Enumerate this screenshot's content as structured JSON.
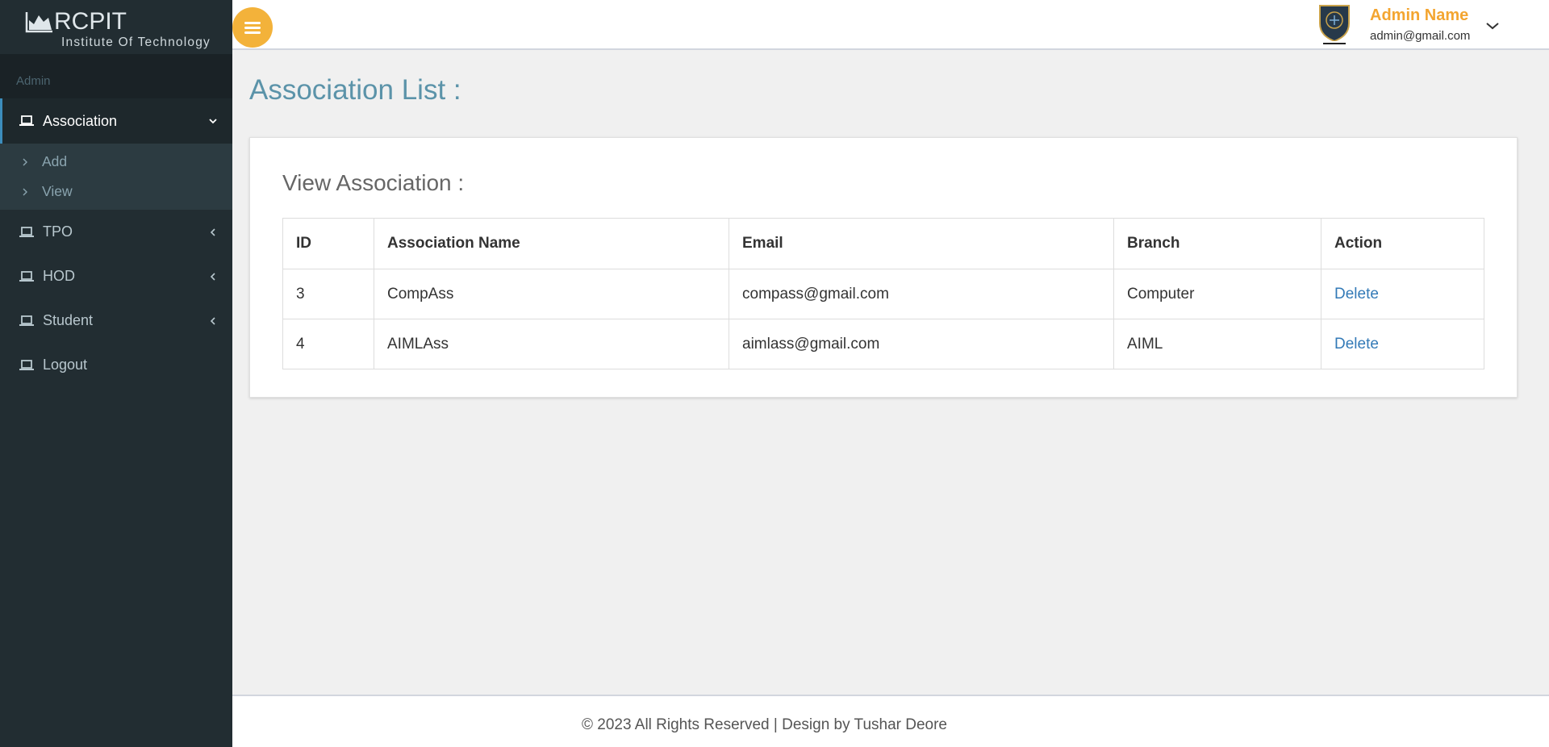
{
  "brand": {
    "name": "RCPIT",
    "subtitle": "Institute Of Technology"
  },
  "sidebar": {
    "header": "Admin",
    "items": [
      {
        "label": "Association",
        "icon": "laptop-icon",
        "expanded": true
      },
      {
        "label": "TPO",
        "icon": "laptop-icon"
      },
      {
        "label": "HOD",
        "icon": "laptop-icon"
      },
      {
        "label": "Student",
        "icon": "laptop-icon"
      },
      {
        "label": "Logout",
        "icon": "laptop-icon"
      }
    ],
    "association_submenu": [
      {
        "label": "Add"
      },
      {
        "label": "View"
      }
    ]
  },
  "topbar": {
    "user_name": "Admin Name",
    "user_email": "admin@gmail.com",
    "accent_color": "#f3b23a"
  },
  "main": {
    "page_title": "Association List :",
    "card_title": "View Association :",
    "table": {
      "headers": [
        "ID",
        "Association Name",
        "Email",
        "Branch",
        "Action"
      ],
      "rows": [
        [
          "3",
          "CompAss",
          "compass@gmail.com",
          "Computer",
          "Delete"
        ],
        [
          "4",
          "AIMLAss",
          "aimlass@gmail.com",
          "AIML",
          "Delete"
        ]
      ]
    }
  },
  "footer": {
    "text": "© 2023 All Rights Reserved | Design by Tushar Deore"
  }
}
